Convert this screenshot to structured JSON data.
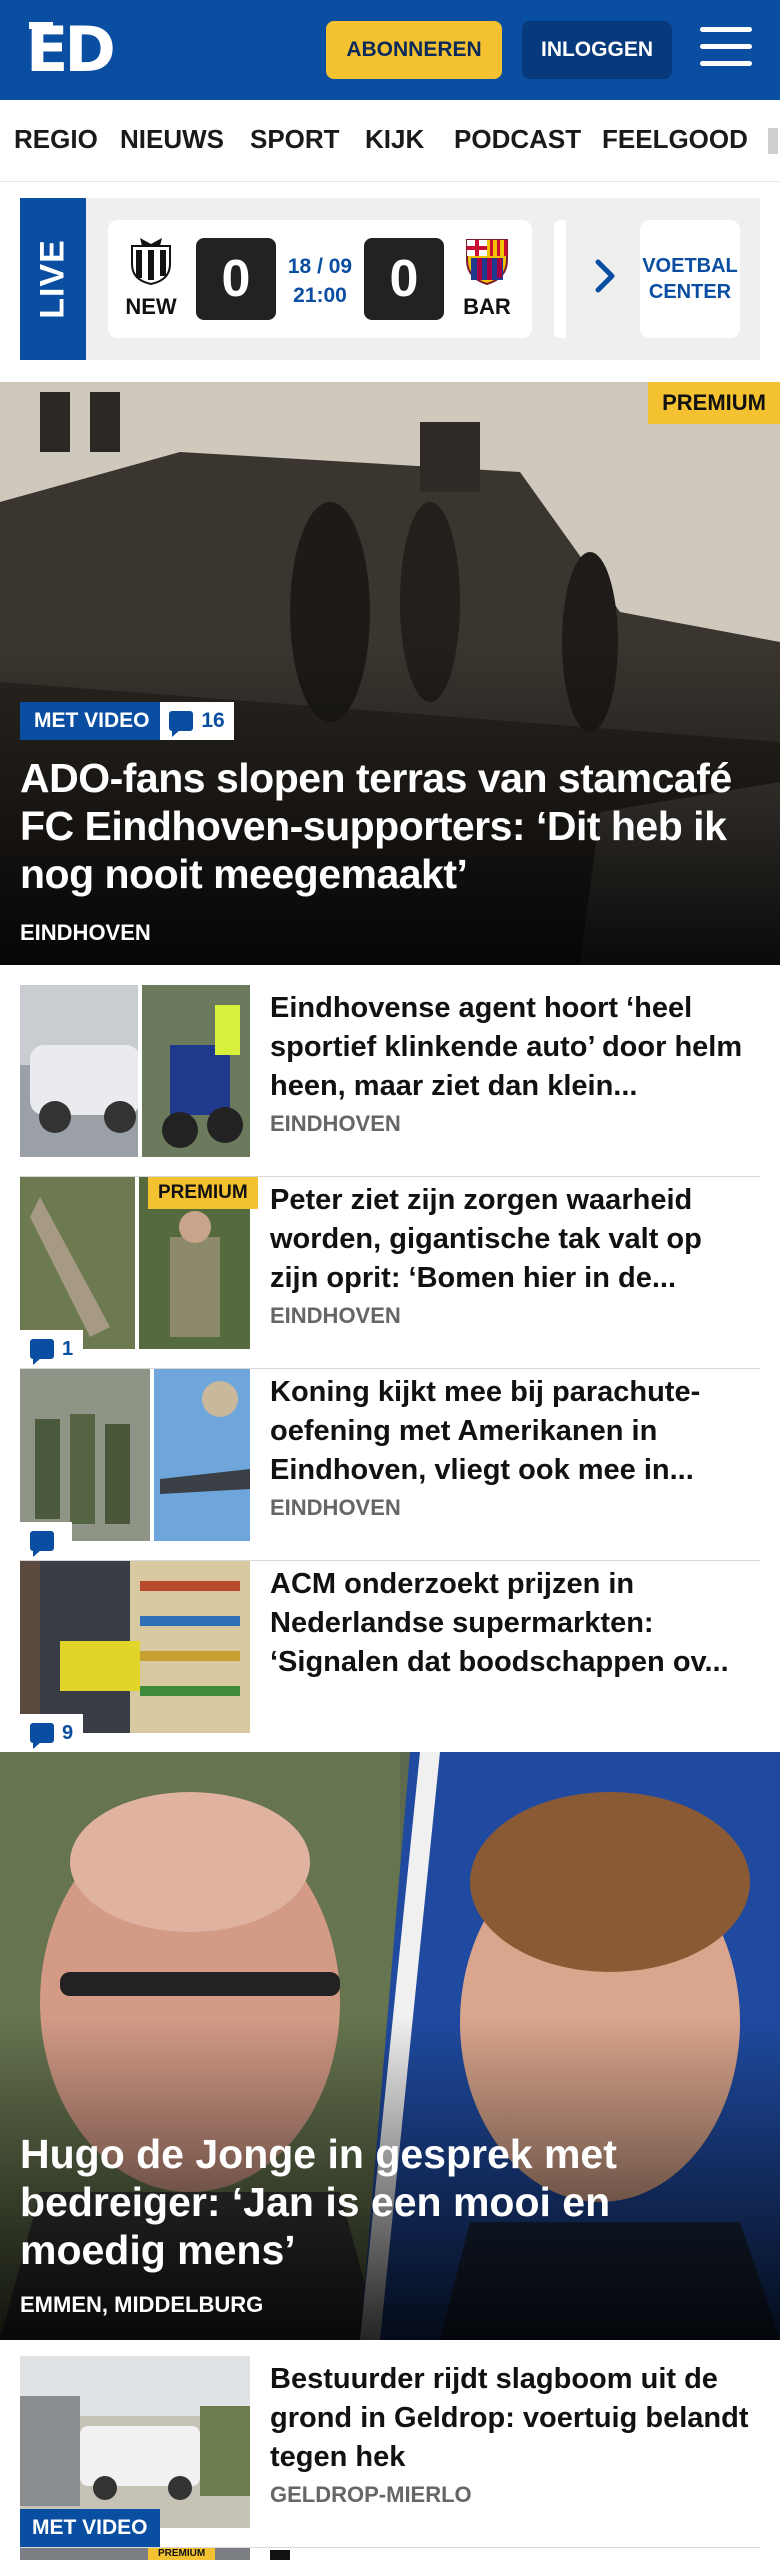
{
  "header": {
    "logo": "ED",
    "subscribe_label": "ABONNEREN",
    "login_label": "INLOGGEN"
  },
  "nav": {
    "items": [
      "REGIO",
      "NIEUWS",
      "SPORT",
      "KIJK",
      "PODCAST",
      "FEELGOOD"
    ]
  },
  "live": {
    "label": "LIVE",
    "match": {
      "home_code": "NEW",
      "away_code": "BAR",
      "home_score": "0",
      "away_score": "0",
      "date": "18 / 09",
      "time": "21:00"
    },
    "voetbal_center_label": "VOETBAL CENTER"
  },
  "hero": {
    "premium_label": "PREMIUM",
    "video_label": "MET VIDEO",
    "comments": "16",
    "title": "ADO-fans slopen terras van stamcafé FC Eindhoven-supporters: ‘Dit heb ik nog nooit meegemaakt’",
    "location": "EINDHOVEN"
  },
  "articles": [
    {
      "title": "Eindhovense agent hoort ‘heel sportief klinkende auto’ door helm heen, maar ziet dan klein...",
      "location": "EINDHOVEN",
      "premium": "",
      "comments": ""
    },
    {
      "title": "Peter ziet zijn zorgen waarheid worden, gigantische tak valt op zijn oprit: ‘Bomen hier in de...",
      "location": "EINDHOVEN",
      "premium": "PREMIUM",
      "comments": "1"
    },
    {
      "title": "Koning kijkt mee bij parachute-oefening met Amerikanen in Eindhoven, vliegt ook mee in...",
      "location": "EINDHOVEN",
      "premium": "",
      "comments": ""
    },
    {
      "title": "ACM onderzoekt prijzen in Nederlandse supermarkten: ‘Signalen dat boodschappen ov...",
      "location": "",
      "premium": "",
      "comments": "9"
    }
  ],
  "big_story": {
    "title": "Hugo de Jonge in gesprek met bedreiger: ‘Jan is een mooi en moedig mens’",
    "location": "EMMEN, MIDDELBURG"
  },
  "last_article": {
    "title": "Bestuurder rijdt slagboom uit de grond in Geldrop: voertuig belandt tegen hek",
    "location": "GELDROP-MIERLO",
    "video_label": "MET VIDEO",
    "next_premium_label": "PREMIUM"
  },
  "colors": {
    "brand_blue": "#0a4ea2",
    "accent_yellow": "#f4c230"
  }
}
